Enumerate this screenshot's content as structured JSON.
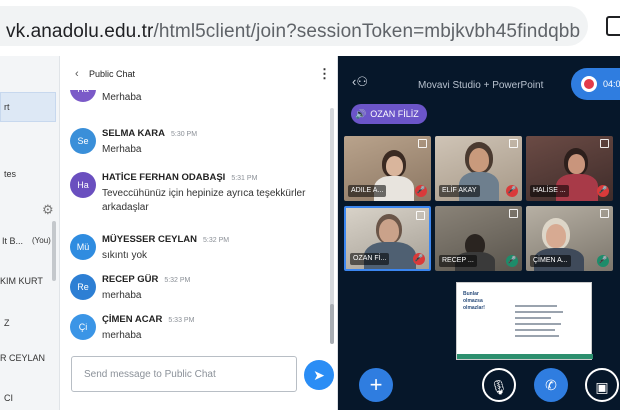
{
  "browser": {
    "url_host": "vk.anadolu.edu.tr",
    "url_path": "/html5client/join?sessionToken=mbjkvbh45findqbb"
  },
  "userlist": {
    "fragments": [
      "rt",
      "tes",
      "It B...",
      "(You)",
      "KIM KURT",
      "Z",
      "R CEYLAN",
      "CI"
    ]
  },
  "chat": {
    "title": "Public Chat",
    "messages": [
      {
        "initials": "Ha",
        "color": "#7b5ac8",
        "name": "",
        "time": "",
        "text": "Merhaba"
      },
      {
        "initials": "Se",
        "color": "#3a8fd9",
        "name": "SELMA KARA",
        "time": "5:30 PM",
        "text": "Merhaba"
      },
      {
        "initials": "Ha",
        "color": "#6a4fbf",
        "name": "HATİCE FERHAN ODABAŞI",
        "time": "5:31 PM",
        "text": "Teveccühünüz için hepinize ayrıca teşekkürler arkadaşlar"
      },
      {
        "initials": "Mü",
        "color": "#2f8ce0",
        "name": "MÜYESSER CEYLAN",
        "time": "5:32 PM",
        "text": "sıkıntı yok"
      },
      {
        "initials": "Re",
        "color": "#2d7fd4",
        "name": "RECEP GÜR",
        "time": "5:32 PM",
        "text": "merhaba"
      },
      {
        "initials": "Çi",
        "color": "#3b95e6",
        "name": "ÇİMEN ACAR",
        "time": "5:33 PM",
        "text": "merhaba"
      }
    ],
    "input_placeholder": "Send message to Public Chat"
  },
  "presentation": {
    "title": "Movavi Studio + PowerPoint",
    "recording_time": "04:0",
    "talker": "OZAN FİLİZ",
    "tiles": [
      {
        "name": "ADILE A...",
        "mic": "muted"
      },
      {
        "name": "ELİF AKAY",
        "mic": "muted"
      },
      {
        "name": "HALİSE ...",
        "mic": "muted"
      },
      {
        "name": "OZAN Fİ...",
        "mic": "muted"
      },
      {
        "name": "RECEP ...",
        "mic": "on"
      },
      {
        "name": "ÇİMEN A...",
        "mic": "on"
      }
    ],
    "slide_title": "Bunlar olmazsa olmazlar!"
  },
  "colors": {
    "accent": "#2f7de0",
    "presentation_bg": "#06172a",
    "talker_bg": "#6b55c9",
    "muted_red": "#d93a3a",
    "mic_on_green": "#1d8c6a"
  }
}
